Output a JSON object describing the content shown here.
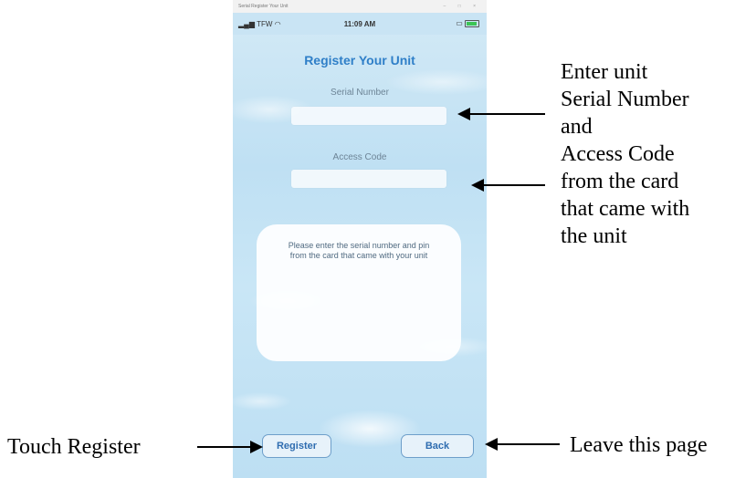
{
  "phone": {
    "window_title": "Serial Register Your Unit",
    "window_controls": "–  □  ×",
    "status": {
      "carrier": "TFW",
      "time": "11:09 AM"
    },
    "title": "Register Your Unit",
    "serial_label": "Serial Number",
    "serial_value": "",
    "access_label": "Access Code",
    "access_value": "",
    "info_text": "Please enter the serial number and pin from the card that came with your unit",
    "register_button": "Register",
    "back_button": "Back"
  },
  "annotations": {
    "enter_lines": [
      "Enter unit",
      "Serial Number",
      "and",
      "Access Code",
      "from the card",
      "that came with",
      "the unit"
    ],
    "touch_register": "Touch Register",
    "leave_page": "Leave this page"
  },
  "colors": {
    "accent": "#2f7fc8",
    "background": "#c9e6f6"
  }
}
